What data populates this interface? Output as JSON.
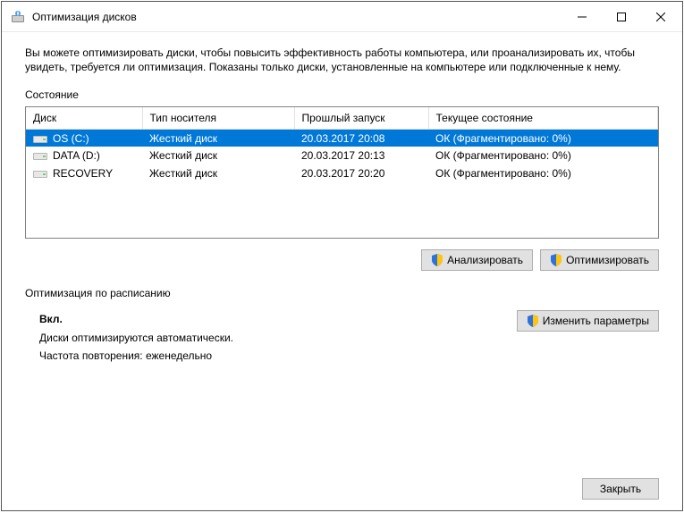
{
  "titlebar": {
    "title": "Оптимизация дисков"
  },
  "intro": "Вы можете оптимизировать диски, чтобы повысить эффективность работы компьютера, или проанализировать их, чтобы увидеть, требуется ли оптимизация. Показаны только диски, установленные на компьютере или подключенные к нему.",
  "status_label": "Состояние",
  "columns": {
    "disk": "Диск",
    "media": "Тип носителя",
    "last_run": "Прошлый запуск",
    "current": "Текущее состояние"
  },
  "rows": [
    {
      "disk": "OS (C:)",
      "media": "Жесткий диск",
      "last_run": "20.03.2017 20:08",
      "current": "ОК (Фрагментировано: 0%)",
      "selected": true
    },
    {
      "disk": "DATA (D:)",
      "media": "Жесткий диск",
      "last_run": "20.03.2017 20:13",
      "current": "ОК (Фрагментировано: 0%)",
      "selected": false
    },
    {
      "disk": "RECOVERY",
      "media": "Жесткий диск",
      "last_run": "20.03.2017 20:20",
      "current": "ОК (Фрагментировано: 0%)",
      "selected": false
    }
  ],
  "buttons": {
    "analyze": "Анализировать",
    "optimize": "Оптимизировать",
    "change_settings": "Изменить параметры",
    "close": "Закрыть"
  },
  "schedule": {
    "label": "Оптимизация по расписанию",
    "state": "Вкл.",
    "line1": "Диски оптимизируются автоматически.",
    "line2": "Частота повторения: еженедельно"
  }
}
